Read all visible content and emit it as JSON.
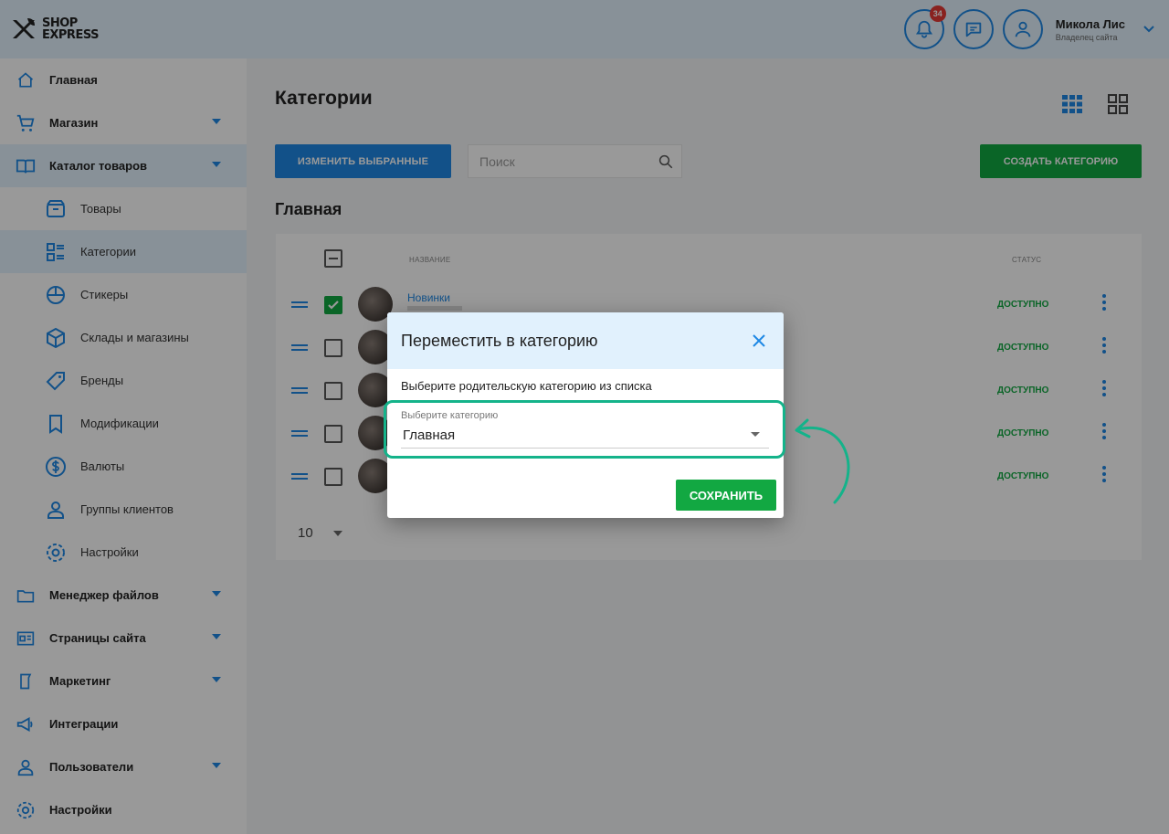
{
  "header": {
    "logo_line1": "SHOP",
    "logo_line2": "EXPRESS",
    "notifications_count": "34",
    "user_name": "Микола Лис",
    "user_role": "Владелец сайта"
  },
  "sidebar": {
    "items": [
      {
        "label": "Главная",
        "icon": "home-icon"
      },
      {
        "label": "Магазин",
        "icon": "cart-icon",
        "has_children": true
      },
      {
        "label": "Каталог товаров",
        "icon": "book-icon",
        "has_children": true,
        "active": true
      },
      {
        "label": "Менеджер файлов",
        "icon": "folder-icon",
        "has_children": true
      },
      {
        "label": "Страницы сайта",
        "icon": "pages-icon",
        "has_children": true
      },
      {
        "label": "Маркетинг",
        "icon": "marketing-icon",
        "has_children": true
      },
      {
        "label": "Интеграции",
        "icon": "megaphone-icon"
      },
      {
        "label": "Пользователи",
        "icon": "users-icon",
        "has_children": true
      },
      {
        "label": "Настройки",
        "icon": "gear-icon"
      }
    ],
    "catalog_sub": [
      {
        "label": "Товары",
        "icon": "box-icon"
      },
      {
        "label": "Категории",
        "icon": "categories-icon",
        "active": true
      },
      {
        "label": "Стикеры",
        "icon": "sticker-icon"
      },
      {
        "label": "Склады и магазины",
        "icon": "warehouse-icon"
      },
      {
        "label": "Бренды",
        "icon": "tag-icon"
      },
      {
        "label": "Модификации",
        "icon": "bookmark-icon"
      },
      {
        "label": "Валюты",
        "icon": "dollar-icon"
      },
      {
        "label": "Группы клиентов",
        "icon": "user-group-icon"
      },
      {
        "label": "Настройки",
        "icon": "gear-icon"
      }
    ]
  },
  "main": {
    "title": "Категории",
    "edit_selected_label": "ИЗМЕНИТЬ ВЫБРАННЫЕ",
    "search_placeholder": "Поиск",
    "create_category_label": "СОЗДАТЬ КАТЕГОРИЮ",
    "section_title": "Главная",
    "table": {
      "col_name": "НАЗВАНИЕ",
      "col_status": "СТАТУС",
      "rows": [
        {
          "name": "Новинки",
          "status": "ДОСТУПНО",
          "checked": true
        },
        {
          "name": "",
          "status": "ДОСТУПНО",
          "checked": false
        },
        {
          "name": "",
          "status": "ДОСТУПНО",
          "checked": false
        },
        {
          "name": "",
          "status": "ДОСТУПНО",
          "checked": false
        },
        {
          "name": "",
          "status": "ДОСТУПНО",
          "checked": false
        }
      ]
    },
    "per_page": "10"
  },
  "modal": {
    "title": "Переместить в категорию",
    "description": "Выберите родительскую категорию из списка",
    "select_label": "Выберите категорию",
    "select_value": "Главная",
    "save_label": "СОХРАНИТЬ"
  },
  "colors": {
    "primary": "#1e88e5",
    "success": "#12a842",
    "highlight": "#14b38a"
  }
}
